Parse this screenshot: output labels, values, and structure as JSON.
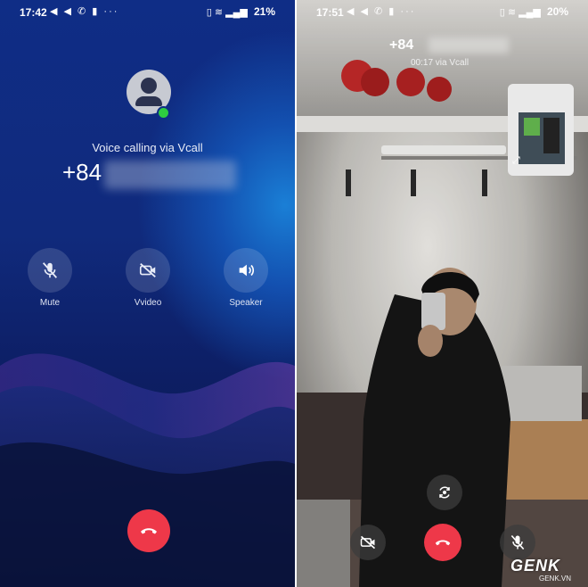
{
  "left": {
    "status": {
      "time": "17:42",
      "icons": "◀ ◀ ✆ ▮ ···",
      "battery": "21%"
    },
    "calling_label": "Voice calling via Vcall",
    "phone_prefix": "+84",
    "controls": [
      {
        "label": "Mute",
        "icon": "mic-off-icon"
      },
      {
        "label": "Vvideo",
        "icon": "video-off-icon"
      },
      {
        "label": "Speaker",
        "icon": "speaker-icon"
      }
    ],
    "end_call_icon": "end-call-icon",
    "colors": {
      "end_call": "#ee3849",
      "online": "#2ecc40"
    }
  },
  "right": {
    "status": {
      "time": "17:51",
      "icons": "◀ ◀ ✆ ▮ ···",
      "battery": "20%"
    },
    "phone_prefix": "+84",
    "subtitle": "00:17 via Vcall",
    "controls": [
      {
        "icon": "video-off-icon"
      },
      {
        "icon": "end-call-icon"
      },
      {
        "icon": "mic-off-icon"
      },
      {
        "icon": "switch-camera-icon"
      }
    ],
    "watermark": "GENK",
    "watermark_sub": "GENK.VN"
  }
}
